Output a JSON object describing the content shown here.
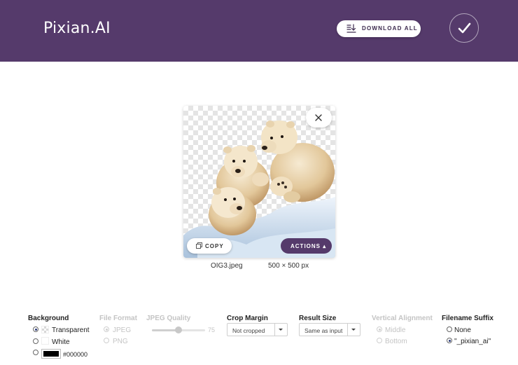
{
  "header": {
    "logo": "Pixian.AI",
    "download_all_label": "DOWNLOAD ALL",
    "accent_color": "#553a6b"
  },
  "image_card": {
    "copy_label": "COPY",
    "actions_label": "ACTIONS",
    "filename": "OIG3.jpeg",
    "dimensions": "500 × 500 px"
  },
  "options": {
    "background": {
      "title": "Background",
      "choices": [
        {
          "label": "Transparent",
          "selected": true
        },
        {
          "label": "White",
          "selected": false
        },
        {
          "label": "#000000",
          "selected": false
        }
      ],
      "custom_color": "#000000"
    },
    "file_format": {
      "title": "File Format",
      "disabled": true,
      "choices": [
        {
          "label": "JPEG",
          "selected": true
        },
        {
          "label": "PNG",
          "selected": false
        }
      ]
    },
    "jpeg_quality": {
      "title": "JPEG Quality",
      "disabled": true,
      "value": "75",
      "fraction": 0.5
    },
    "crop_margin": {
      "title": "Crop Margin",
      "value": "Not cropped"
    },
    "result_size": {
      "title": "Result Size",
      "value": "Same as input"
    },
    "vertical_alignment": {
      "title": "Vertical Alignment",
      "disabled": true,
      "choices": [
        {
          "label": "Middle",
          "selected": true
        },
        {
          "label": "Bottom",
          "selected": false
        }
      ]
    },
    "filename_suffix": {
      "title": "Filename Suffix",
      "choices": [
        {
          "label": "None",
          "selected": false
        },
        {
          "label": "\"_pixian_ai\"",
          "selected": true
        }
      ]
    }
  }
}
